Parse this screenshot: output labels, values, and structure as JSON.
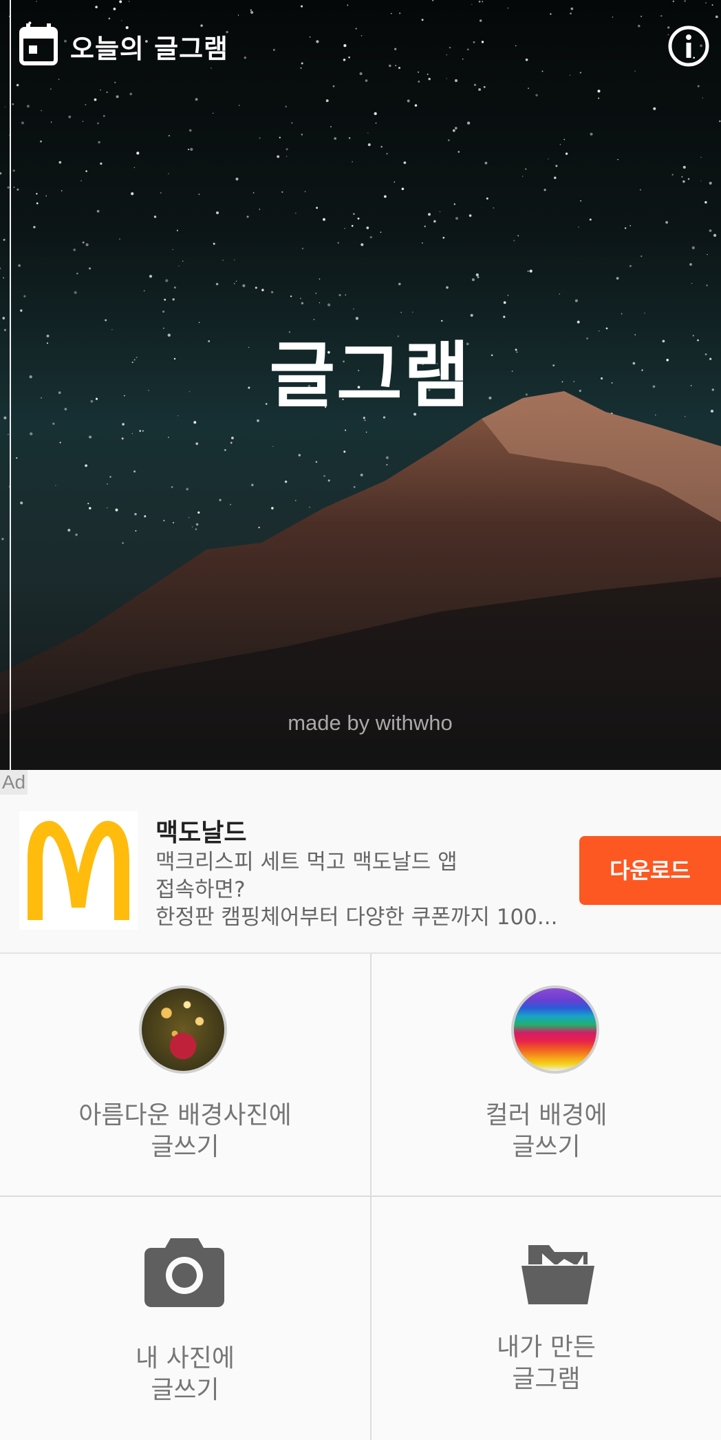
{
  "header": {
    "title": "오늘의 글그램",
    "calendar_icon": "calendar-icon",
    "info_icon": "info-icon"
  },
  "hero": {
    "title": "글그램",
    "credit": "made by withwho"
  },
  "ad": {
    "badge": "Ad",
    "brand": "맥도날드",
    "lines": [
      "맥크리스피 세트 먹고 맥도날드 앱",
      "접속하면?",
      "한정판 캠핑체어부터 다양한 쿠폰까지 100..."
    ],
    "button": "다운로드",
    "button_color": "#fd5722",
    "logo_color": "#ffbc0d"
  },
  "menu": [
    {
      "line1": "아름다운 배경사진에",
      "line2": "글쓰기",
      "icon": "background-photo-thumbnail"
    },
    {
      "line1": "컬러 배경에",
      "line2": "글쓰기",
      "icon": "color-background-thumbnail"
    },
    {
      "line1": "내 사진에",
      "line2": "글쓰기",
      "icon": "camera-icon"
    },
    {
      "line1": "내가 만든",
      "line2": "글그램",
      "icon": "folder-open-icon"
    }
  ]
}
